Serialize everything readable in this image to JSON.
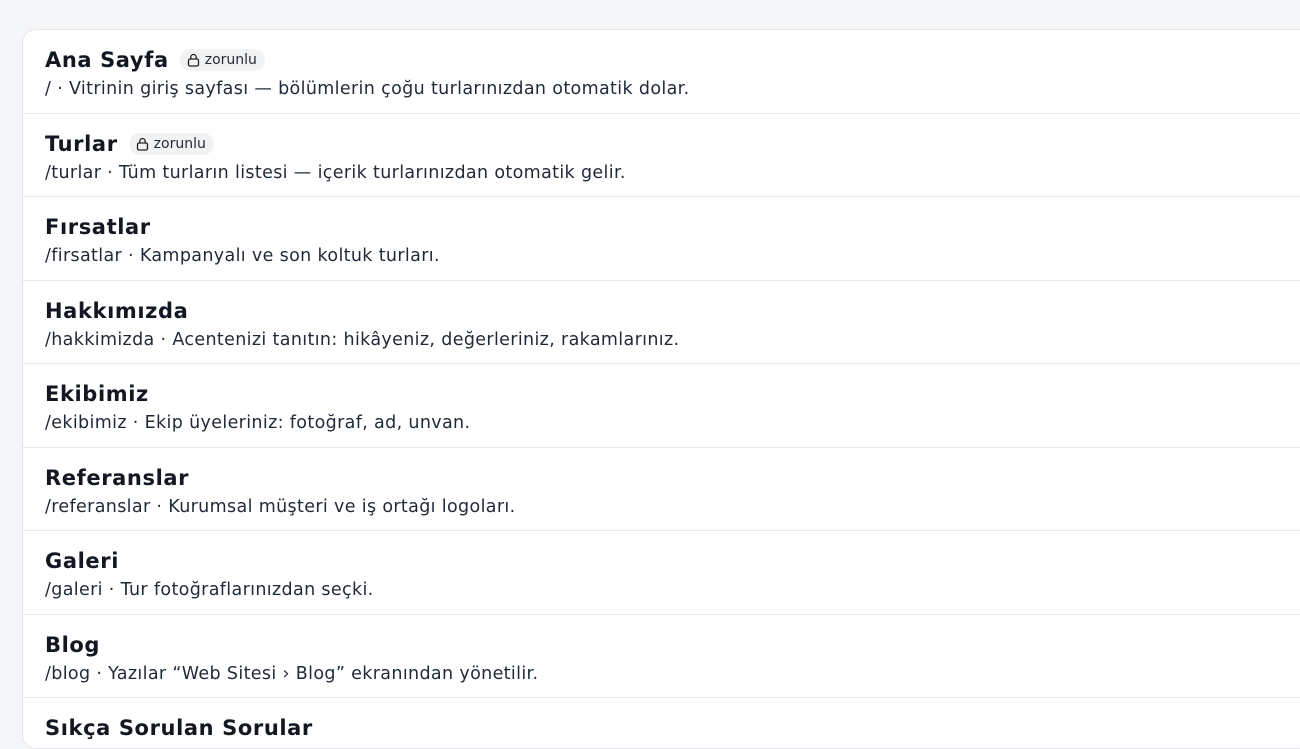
{
  "badge_label": "zorunlu",
  "pages": [
    {
      "title": "Ana Sayfa",
      "description": "/ · Vitrinin giriş sayfası — bölümlerin çoğu turlarınızdan otomatik dolar.",
      "required": true
    },
    {
      "title": "Turlar",
      "description": "/turlar · Tüm turların listesi — içerik turlarınızdan otomatik gelir.",
      "required": true
    },
    {
      "title": "Fırsatlar",
      "description": "/firsatlar · Kampanyalı ve son koltuk turları.",
      "required": false
    },
    {
      "title": "Hakkımızda",
      "description": "/hakkimizda · Acentenizi tanıtın: hikâyeniz, değerleriniz, rakamlarınız.",
      "required": false
    },
    {
      "title": "Ekibimiz",
      "description": "/ekibimiz · Ekip üyeleriniz: fotoğraf, ad, unvan.",
      "required": false
    },
    {
      "title": "Referanslar",
      "description": "/referanslar · Kurumsal müşteri ve iş ortağı logoları.",
      "required": false
    },
    {
      "title": "Galeri",
      "description": "/galeri · Tur fotoğraflarınızdan seçki.",
      "required": false
    },
    {
      "title": "Blog",
      "description": "/blog · Yazılar “Web Sitesi › Blog” ekranından yönetilir.",
      "required": false
    },
    {
      "title": "Sıkça Sorulan Sorular",
      "description": "",
      "required": false
    }
  ]
}
